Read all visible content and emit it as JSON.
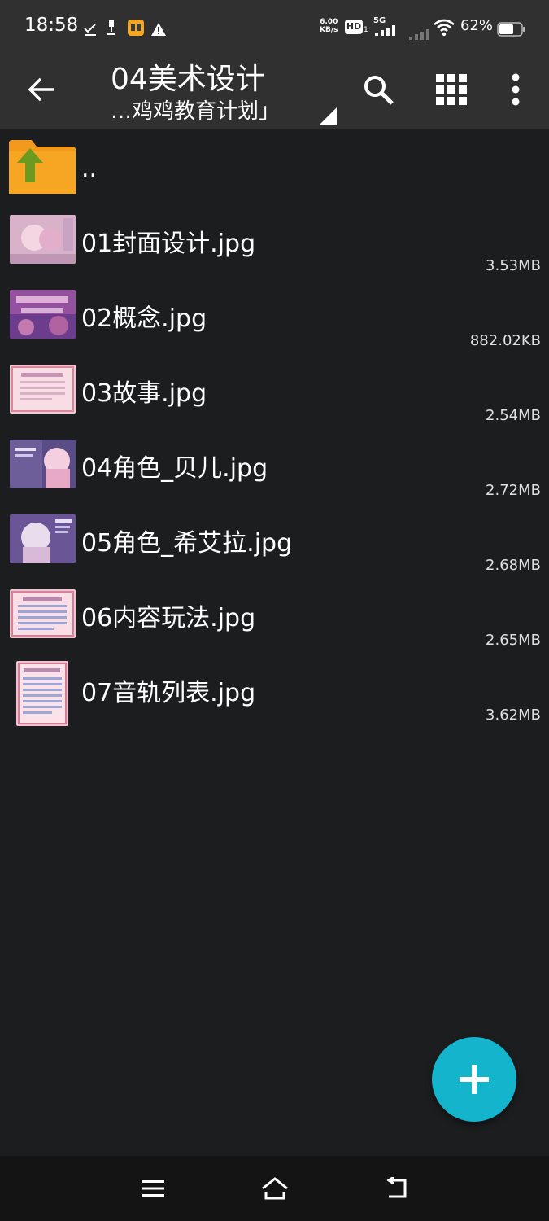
{
  "status_bar": {
    "time": "18:58",
    "net_speed_value": "6.00",
    "net_speed_unit": "KB/s",
    "hd_label": "HD",
    "signal_label": "5G",
    "battery": "62%",
    "icons": [
      "check-download-icon",
      "usb-icon",
      "app-notification-icon",
      "warning-icon",
      "hd-icon",
      "signal-5g-icon",
      "signal-weak-icon",
      "wifi-icon",
      "battery-icon"
    ]
  },
  "app_bar": {
    "title": "04美术设计",
    "subtitle": "…鸡鸡教育计划」",
    "icons": [
      "back-arrow-icon",
      "search-icon",
      "grid-view-icon",
      "more-vert-icon",
      "dropdown-triangle-icon"
    ]
  },
  "files": [
    {
      "name": "..",
      "size": "",
      "type": "parent-folder"
    },
    {
      "name": "01封面设计.jpg",
      "size": "3.53MB",
      "type": "image"
    },
    {
      "name": "02概念.jpg",
      "size": "882.02KB",
      "type": "image"
    },
    {
      "name": "03故事.jpg",
      "size": "2.54MB",
      "type": "image"
    },
    {
      "name": "04角色_贝儿.jpg",
      "size": "2.72MB",
      "type": "image"
    },
    {
      "name": "05角色_希艾拉.jpg",
      "size": "2.68MB",
      "type": "image"
    },
    {
      "name": "06内容玩法.jpg",
      "size": "2.65MB",
      "type": "image"
    },
    {
      "name": "07音轨列表.jpg",
      "size": "3.62MB",
      "type": "image"
    }
  ],
  "fab": {
    "icon": "plus-icon",
    "color": "#13b4cc"
  },
  "nav_bar": {
    "icons": [
      "menu-icon",
      "home-icon",
      "back-icon"
    ]
  },
  "colors": {
    "background": "#1c1d1f",
    "appbar": "#303030",
    "accent": "#13b4cc",
    "folder": "#f29a1d",
    "folder_arrow": "#6a9a1f"
  }
}
